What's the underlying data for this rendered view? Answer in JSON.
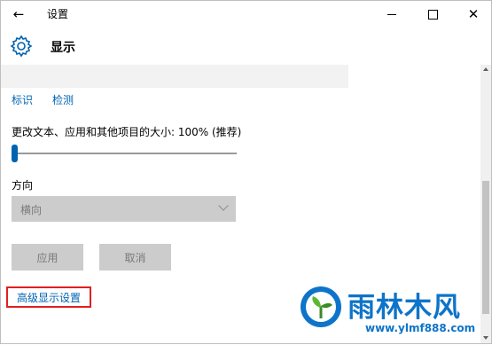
{
  "window": {
    "title": "设置"
  },
  "header": {
    "title": "显示"
  },
  "links": {
    "identify": "标识",
    "detect": "检测",
    "advanced": "高级显示设置"
  },
  "scale": {
    "label": "更改文本、应用和其他项目的大小: 100% (推荐)",
    "value_fraction": 0.0
  },
  "orientation": {
    "label": "方向",
    "selected": "横向"
  },
  "buttons": {
    "apply": "应用",
    "cancel": "取消"
  },
  "watermark": {
    "brand": "雨林木风",
    "url": "www.ylmf888.com"
  },
  "colors": {
    "accent": "#0063b1",
    "disabled": "#cccccc",
    "highlight_border": "#e02020",
    "watermark": "#0d74c9"
  },
  "icons": {
    "back": "back-arrow-icon",
    "settings": "gear-icon",
    "minimize": "minimize-icon",
    "maximize": "maximize-icon",
    "close": "close-icon",
    "dropdown": "chevron-down-icon"
  }
}
